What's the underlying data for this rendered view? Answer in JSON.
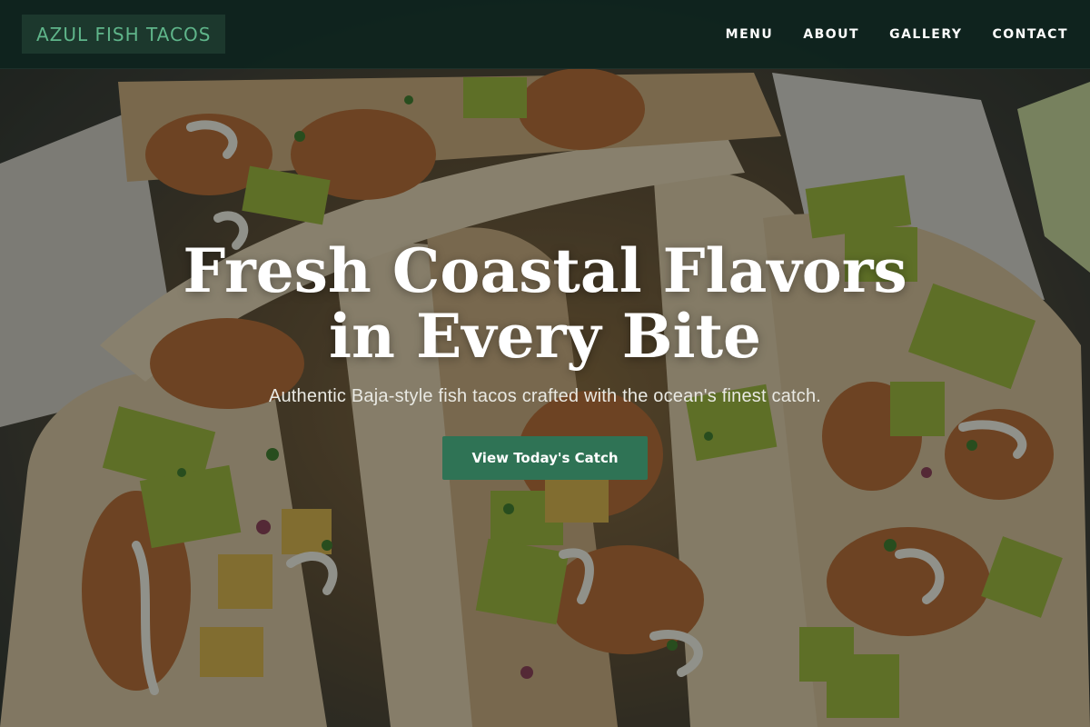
{
  "brand": {
    "name": "AZUL FISH TACOS"
  },
  "nav": {
    "items": [
      {
        "label": "MENU"
      },
      {
        "label": "ABOUT"
      },
      {
        "label": "GALLERY"
      },
      {
        "label": "CONTACT"
      }
    ]
  },
  "hero": {
    "title": "Fresh Coastal Flavors in Every Bite",
    "subtitle": "Authentic Baja-style fish tacos crafted with the ocean's finest catch.",
    "cta_label": "View Today's Catch",
    "background_image": "fish-tacos-photo"
  },
  "colors": {
    "header_bg": "#0e241e",
    "brand_text": "#5fb58a",
    "brand_bg": "#1e3a2e",
    "cta_bg": "#2f7355",
    "text": "#ffffff"
  }
}
